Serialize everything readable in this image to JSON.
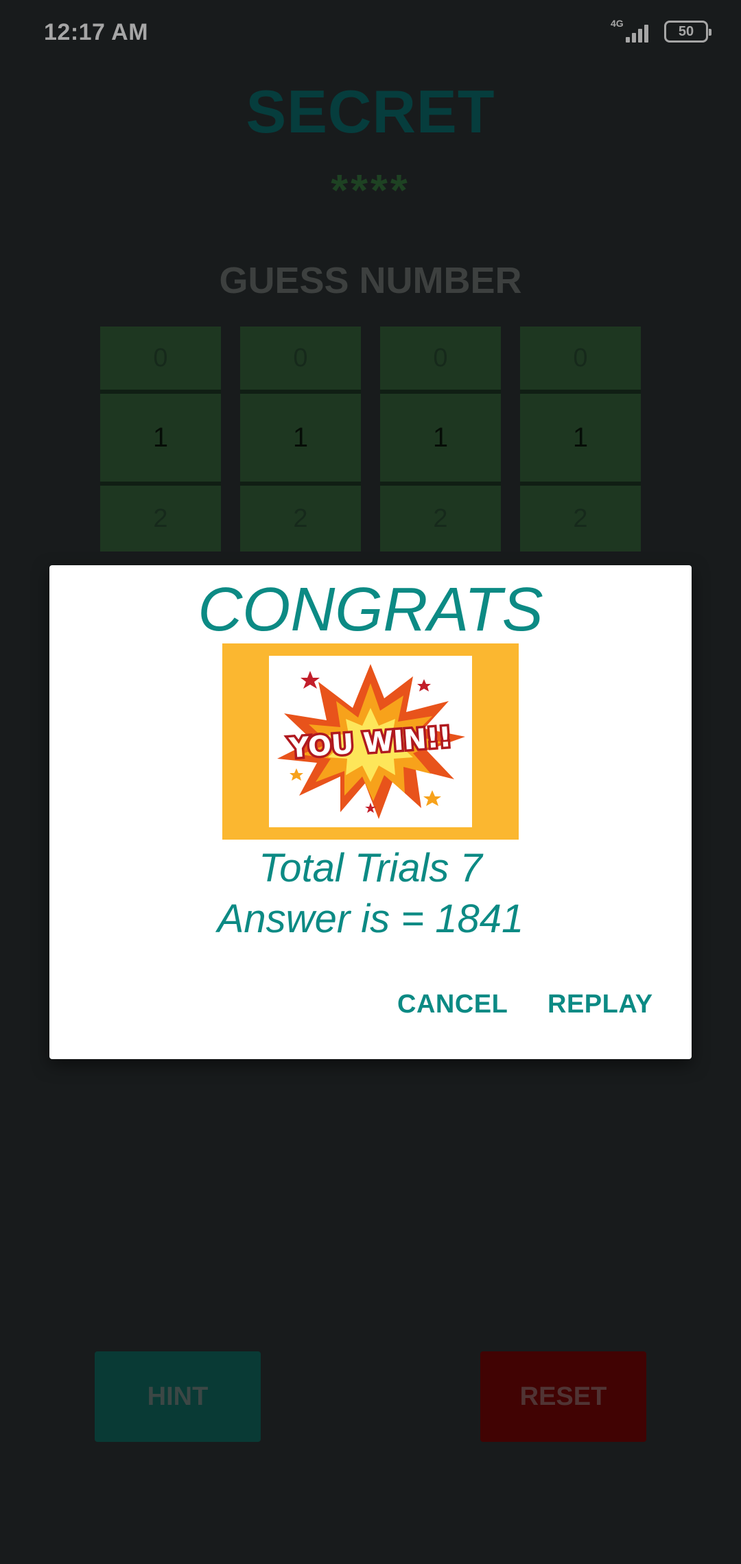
{
  "status_bar": {
    "time": "12:17 AM",
    "network": "4G",
    "battery": "50",
    "icons": [
      "signal-icon",
      "battery-icon"
    ]
  },
  "game": {
    "title": "SECRET",
    "secret_mask": "****",
    "guess_label": "GUESS NUMBER",
    "pickers": [
      {
        "above": "0",
        "selected": "1",
        "below": "2"
      },
      {
        "above": "0",
        "selected": "1",
        "below": "2"
      },
      {
        "above": "0",
        "selected": "1",
        "below": "2"
      },
      {
        "above": "0",
        "selected": "1",
        "below": "2"
      }
    ],
    "hint_label": "HINT",
    "reset_label": "RESET"
  },
  "dialog": {
    "title": "CONGRATS",
    "image_text": "YOU WIN!!",
    "trials_text": "Total Trials 7",
    "answer_text": "Answer is = 1841",
    "cancel_label": "CANCEL",
    "replay_label": "REPLAY"
  },
  "colors": {
    "background": "#252a2b",
    "accent_teal": "#0c8a84",
    "picker_green": "#2f5533",
    "hint": "#0e5a52",
    "reset": "#640606",
    "win_frame": "#fbb730"
  }
}
